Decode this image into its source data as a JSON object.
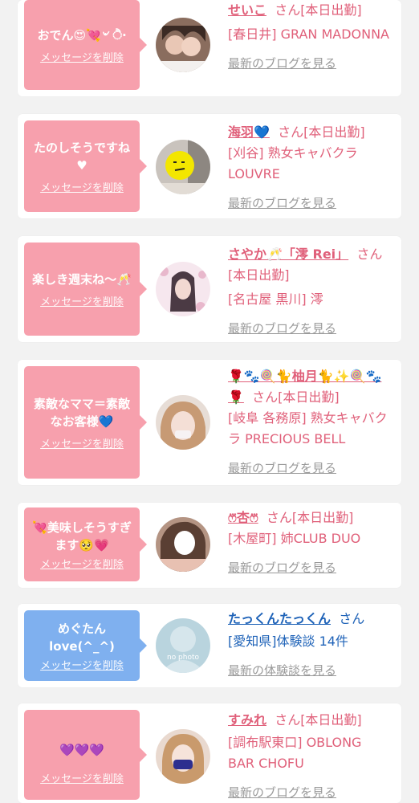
{
  "delete_label": "メッセージを削除",
  "cards": [
    {
      "message": "おでん😍💘৺ ੈ‧",
      "name": "せいこ",
      "suffix": "さん[本日出勤]",
      "shop": "[春日井] GRAN MADONNA",
      "link": "最新のブログを見る",
      "accent": "#f7a0ad"
    },
    {
      "message": "たのしそうですね♥",
      "name": "海羽💙",
      "suffix": "さん[本日出勤]",
      "shop": "[刈谷] 熟女キャバクラ LOUVRE",
      "link": "最新のブログを見る",
      "accent": "#f7a0ad"
    },
    {
      "message": "楽しき週末ね〜🥂",
      "name": "さやか🥂「澪 Rei」",
      "suffix": "さん[本日出勤]",
      "shop": "[名古屋 黒川] 澪",
      "link": "最新のブログを見る",
      "accent": "#f7a0ad"
    },
    {
      "message": "素敵なママ＝素敵なお客様💙",
      "name": "🌹🐾🍭🐈柚月🐈✨🍭🐾🌹",
      "suffix": "さん[本日出勤]",
      "shop": "[岐阜 各務原] 熟女キャバクラ PRECIOUS BELL",
      "link": "最新のブログを見る",
      "accent": "#f7a0ad"
    },
    {
      "message": "💘美味しそうすぎます🥺💗",
      "name": "ෆ⃛杏ෆ⃛",
      "suffix": "さん[本日出勤]",
      "shop": "[木屋町] 姉CLUB DUO",
      "link": "最新のブログを見る",
      "accent": "#f7a0ad"
    },
    {
      "message": "めぐたんlove(^_^)",
      "name": "たっくんたっくん",
      "suffix": "さん",
      "shop": "[愛知県]体験談 14件",
      "link": "最新の体験談を見る",
      "accent": "#7fb0ef",
      "avatar_text": "no photo"
    },
    {
      "message": "💜💜💜",
      "name": "すみれ",
      "suffix": "さん[本日出勤]",
      "shop": "[調布駅東口] OBLONG BAR CHOFU",
      "link": "最新のブログを見る",
      "accent": "#f7a0ad"
    }
  ]
}
